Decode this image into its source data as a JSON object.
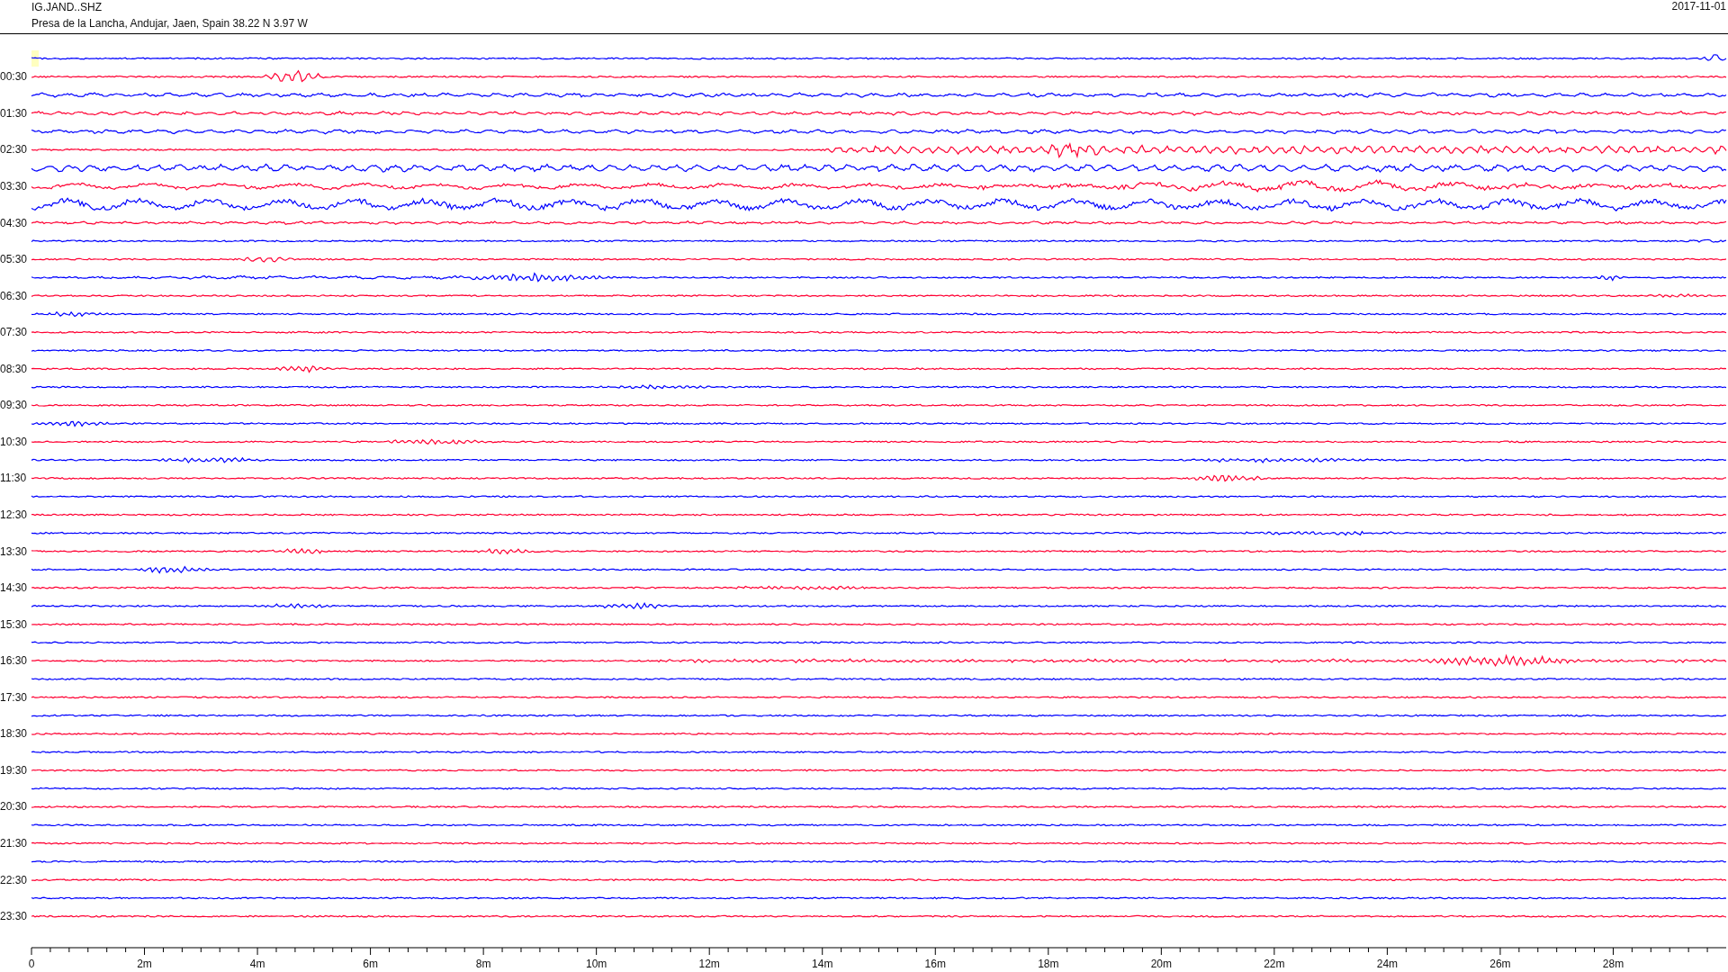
{
  "header": {
    "station": "IG.JAND..SHZ",
    "location": "Presa de la Lancha, Andujar, Jaen, Spain  38.22 N 3.97 W",
    "date": "2017-11-01"
  },
  "traces": [
    {
      "color": "#0000ff"
    },
    {
      "label": "00:30",
      "color": "#ff0033"
    },
    {
      "color": "#0000ff"
    },
    {
      "label": "01:30",
      "color": "#ff0033"
    },
    {
      "color": "#0000ff"
    },
    {
      "label": "02:30",
      "color": "#ff0033"
    },
    {
      "color": "#0000ff"
    },
    {
      "label": "03:30",
      "color": "#ff0033"
    },
    {
      "color": "#0000ff"
    },
    {
      "label": "04:30",
      "color": "#ff0033"
    },
    {
      "color": "#0000ff"
    },
    {
      "label": "05:30",
      "color": "#ff0033"
    },
    {
      "color": "#0000ff"
    },
    {
      "label": "06:30",
      "color": "#ff0033"
    },
    {
      "color": "#0000ff"
    },
    {
      "label": "07:30",
      "color": "#ff0033"
    },
    {
      "color": "#0000ff"
    },
    {
      "label": "08:30",
      "color": "#ff0033"
    },
    {
      "color": "#0000ff"
    },
    {
      "label": "09:30",
      "color": "#ff0033"
    },
    {
      "color": "#0000ff"
    },
    {
      "label": "10:30",
      "color": "#ff0033"
    },
    {
      "color": "#0000ff"
    },
    {
      "label": "11:30",
      "color": "#ff0033"
    },
    {
      "color": "#0000ff"
    },
    {
      "label": "12:30",
      "color": "#ff0033"
    },
    {
      "color": "#0000ff"
    },
    {
      "label": "13:30",
      "color": "#ff0033"
    },
    {
      "color": "#0000ff"
    },
    {
      "label": "14:30",
      "color": "#ff0033"
    },
    {
      "color": "#0000ff"
    },
    {
      "label": "15:30",
      "color": "#ff0033"
    },
    {
      "color": "#0000ff"
    },
    {
      "label": "16:30",
      "color": "#ff0033"
    },
    {
      "color": "#0000ff"
    },
    {
      "label": "17:30",
      "color": "#ff0033"
    },
    {
      "color": "#0000ff"
    },
    {
      "label": "18:30",
      "color": "#ff0033"
    },
    {
      "color": "#0000ff"
    },
    {
      "label": "19:30",
      "color": "#ff0033"
    },
    {
      "color": "#0000ff"
    },
    {
      "label": "20:30",
      "color": "#ff0033"
    },
    {
      "color": "#0000ff"
    },
    {
      "label": "21:30",
      "color": "#ff0033"
    },
    {
      "color": "#0000ff"
    },
    {
      "label": "22:30",
      "color": "#ff0033"
    },
    {
      "color": "#0000ff"
    },
    {
      "label": "23:30",
      "color": "#ff0033"
    }
  ],
  "x_axis": {
    "ticks": [
      "0",
      "2m",
      "4m",
      "6m",
      "8m",
      "10m",
      "12m",
      "14m",
      "16m",
      "18m",
      "20m",
      "22m",
      "24m",
      "26m",
      "28m"
    ]
  }
}
